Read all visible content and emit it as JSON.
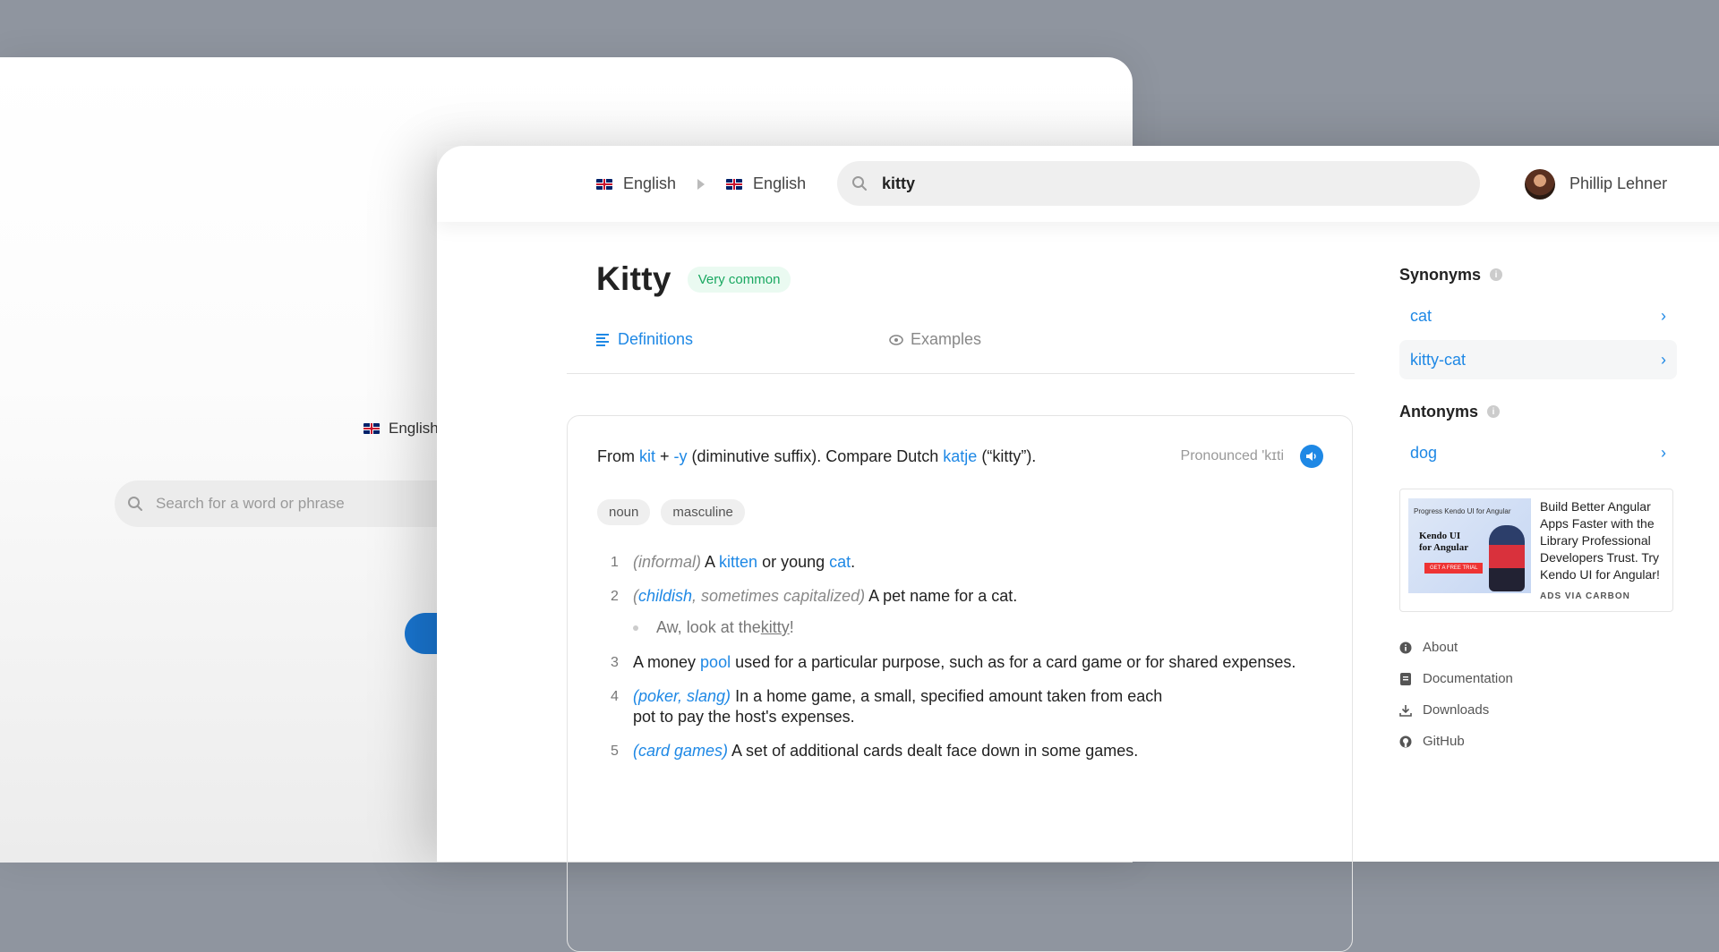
{
  "back": {
    "language": "English",
    "search_placeholder": "Search for a word or phrase"
  },
  "header": {
    "source_language": "English",
    "target_language": "English",
    "search_value": "kitty",
    "user_name": "Phillip Lehner"
  },
  "entry": {
    "word": "Kitty",
    "frequency_badge": "Very common",
    "tabs": [
      {
        "label": "Definitions",
        "icon": "list-icon"
      },
      {
        "label": "Examples",
        "icon": "eye-icon"
      }
    ],
    "etymology": {
      "t1": "From ",
      "l1": "kit",
      "t2": " + ",
      "l2": "-y",
      "t3": " (diminutive suffix). Compare Dutch ",
      "l3": "katje",
      "t4": " (“kitty”)."
    },
    "pronounced": "Pronounced 'kɪti",
    "tags": [
      "noun",
      "masculine"
    ],
    "definitions": [
      {
        "num": "1",
        "qual": "(informal)",
        "a": " A ",
        "link1": "kitten",
        "b": " or young ",
        "link2": "cat",
        "c": "."
      },
      {
        "num": "2",
        "qual_link": "childish",
        "qual_rest": ", sometimes capitalized)",
        "text": " A pet name for a cat."
      },
      {
        "num": "3",
        "a": "A money ",
        "link": "pool",
        "b": " used for a particular purpose, such as for a card game or for shared expenses."
      },
      {
        "num": "4",
        "qual": "(poker, slang)",
        "line1": " In a home game, a small, specified amount taken from each",
        "line2": "pot to pay the host's expenses."
      },
      {
        "num": "5",
        "qual": "(card games)",
        "text": " A set of additional cards dealt face down in some games."
      }
    ],
    "example": {
      "pre": "Aw, look at the ",
      "word": "kitty",
      "post": "!"
    }
  },
  "sidebar": {
    "synonyms_title": "Synonyms",
    "synonyms": [
      "cat",
      "kitty-cat"
    ],
    "antonyms_title": "Antonyms",
    "antonyms": [
      "dog"
    ],
    "ad": {
      "logo": "Progress Kendo UI for Angular",
      "headline": "Kendo UI for Angular",
      "cta": "GET A FREE TRIAL",
      "text": "Build Better Angular Apps Faster with the Library Professional Developers Trust. Try Kendo UI for Angular!",
      "via": "ADS VIA CARBON"
    },
    "links": [
      {
        "label": "About",
        "icon": "info-icon"
      },
      {
        "label": "Documentation",
        "icon": "document-icon"
      },
      {
        "label": "Downloads",
        "icon": "download-icon"
      },
      {
        "label": "GitHub",
        "icon": "github-icon"
      }
    ]
  },
  "colors": {
    "accent": "#1e88e5",
    "badge_green": "#1aa861",
    "backdrop": "#8f959f"
  }
}
